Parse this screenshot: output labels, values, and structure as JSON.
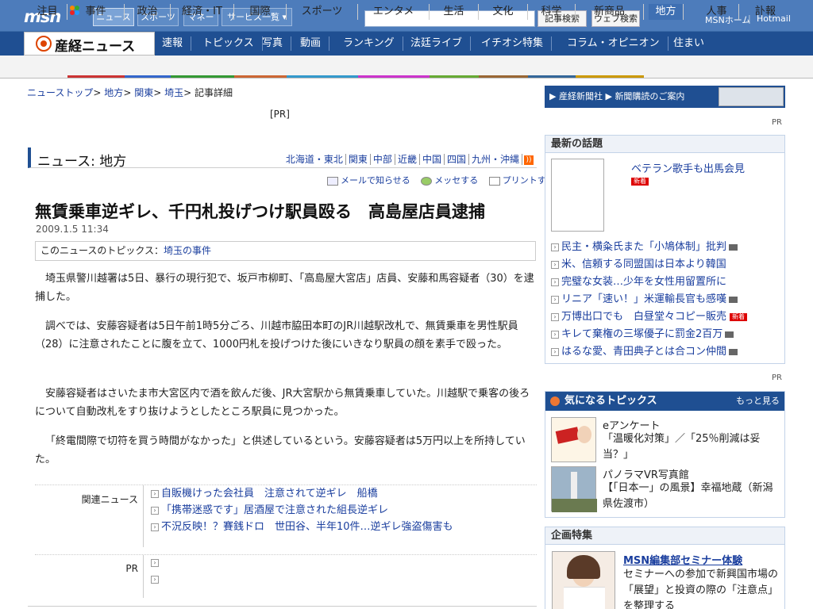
{
  "top": {
    "logo": "msn",
    "nav": [
      "ニュース",
      "スポーツ",
      "マネー",
      "サービス一覧"
    ],
    "search_buttons": [
      "記事検索",
      "ウェブ検索"
    ],
    "links": [
      "MSNホーム",
      "Hotmail"
    ]
  },
  "brand": {
    "name": "産経ニュース",
    "nav": [
      "速報",
      "トピックス",
      "写真",
      "動画",
      "ランキング",
      "法廷ライブ",
      "イチオシ特集",
      "コラム・オピニオン",
      "住まい"
    ]
  },
  "categories": [
    "注目",
    "事件",
    "政治",
    "経済・IT",
    "国際",
    "スポーツ",
    "エンタメ",
    "生活",
    "文化",
    "科学",
    "新商品",
    "地方",
    "人事",
    "訃報"
  ],
  "breadcrumb": [
    "ニューストップ",
    "地方",
    "関東",
    "埼玉",
    "記事詳細"
  ],
  "pr_label": "[PR]",
  "section": {
    "title": "ニュース: 地方",
    "regions": [
      "北海道・東北",
      "関東",
      "中部",
      "近畿",
      "中国",
      "四国",
      "九州・沖縄"
    ]
  },
  "tools": [
    "メールで知らせる",
    "メッセする",
    "プリントする"
  ],
  "article": {
    "headline": "無賃乗車逆ギレ、千円札投げつけ駅員殴る　高島屋店員逮捕",
    "date": "2009.1.5 11:34",
    "topic_label": "このニュースのトピックス：",
    "topic_link": "埼玉の事件",
    "paragraphs": [
      "埼玉県警川越署は5日、暴行の現行犯で、坂戸市柳町、「高島屋大宮店」店員、安藤和馬容疑者（30）を逮捕した。",
      "調べでは、安藤容疑者は5日午前1時5分ごろ、川越市脇田本町のJR川越駅改札で、無賃乗車を男性駅員（28）に注意されたことに腹を立て、1000円札を投げつけた後にいきなり駅員の顔を素手で殴った。",
      "安藤容疑者はさいたま市大宮区内で酒を飲んだ後、JR大宮駅から無賃乗車していた。川越駅で乗客の後ろについて自動改札をすり抜けようとしたところ駅員に見つかった。",
      "「終電間際で切符を買う時間がなかった」と供述しているという。安藤容疑者は5万円以上を所持していた。"
    ]
  },
  "related": {
    "label": "関連ニュース",
    "items": [
      "自販機けった会社員　注意されて逆ギレ　船橋",
      "「携帯迷惑です」居酒屋で注意された組長逆ギレ",
      "不況反映！？賽銭ドロ　世田谷、半年10件…逆ギレ強盗傷害も"
    ]
  },
  "pr_section_label": "PR",
  "sidebar": {
    "subscribe": [
      "産経新聞社",
      "新聞購読のご案内"
    ],
    "pr": "PR",
    "hot": {
      "title": "最新の話題",
      "lead": "ベテラン歌手も出馬会見",
      "new_badge": "新着",
      "items": [
        {
          "text": "民主・横粂氏また「小鳩体制」批判",
          "cam": true,
          "new": false
        },
        {
          "text": "米、信頼する同盟国は日本より韓国",
          "cam": false,
          "new": false
        },
        {
          "text": "完璧な女装…少年を女性用留置所に",
          "cam": false,
          "new": false
        },
        {
          "text": "リニア「速い！」米運輸長官も感嘆",
          "cam": true,
          "new": false
        },
        {
          "text": "万博出口でも　白昼堂々コピー販売",
          "cam": false,
          "new": true
        },
        {
          "text": "キレて棄権の三塚優子に罰金2百万",
          "cam": true,
          "new": false
        },
        {
          "text": "はるな愛、青田典子とは合コン仲間",
          "cam": true,
          "new": false
        }
      ]
    },
    "kini": {
      "title": "気になるトピックス",
      "more": "もっと見る",
      "items": [
        {
          "title": "eアンケート",
          "desc": "「温暖化対策」／「25％削減は妥当？」"
        },
        {
          "title": "パノラマVR写真館",
          "desc": "【「日本一」の風景】幸福地蔵（新潟県佐渡市）"
        }
      ]
    },
    "kikaku": {
      "title": "企画特集",
      "item_title": "MSN編集部セミナー体験",
      "item_desc": "セミナーへの参加で新興国市場の「展望」と投資の際の「注意点」を整理する"
    }
  }
}
